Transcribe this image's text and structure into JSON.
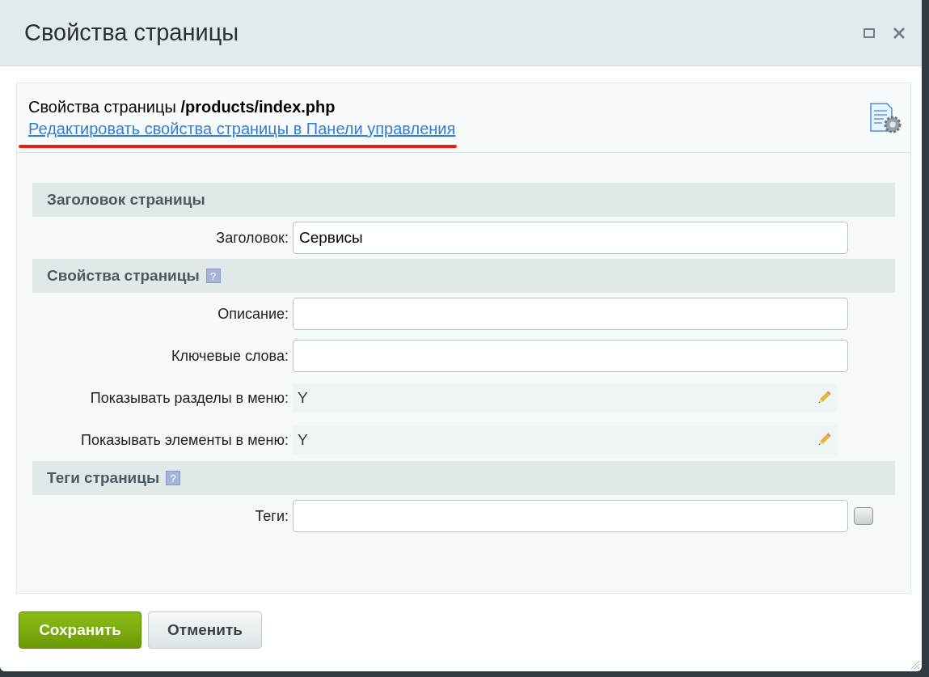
{
  "window": {
    "title": "Свойства страницы"
  },
  "header": {
    "caption": "Свойства страницы **/products/index.php**",
    "link": "Редактировать свойства страницы в Панели управления",
    "underlined": true
  },
  "form": [
    {
      "kind": "section",
      "title": "Заголовок страницы"
    },
    {
      "kind": "input",
      "label": "Заголовок:",
      "value": "Сервисы"
    },
    {
      "kind": "section",
      "title": "Свойства страницы",
      "help": "?"
    },
    {
      "kind": "input",
      "label": "Описание:"
    },
    {
      "kind": "input",
      "label": "Ключевые слова:"
    },
    {
      "kind": "readonly",
      "label": "Показывать разделы в меню:",
      "value": "Y"
    },
    {
      "kind": "readonly",
      "label": "Показывать элементы в меню:",
      "value": "Y"
    },
    {
      "kind": "section",
      "title": "Теги страницы",
      "help": "?"
    },
    {
      "kind": "tags",
      "label": "Теги:"
    }
  ],
  "buttons": [
    {
      "label": "Сохранить",
      "kind": "primary"
    },
    {
      "label": "Отменить",
      "kind": "secondary"
    }
  ]
}
